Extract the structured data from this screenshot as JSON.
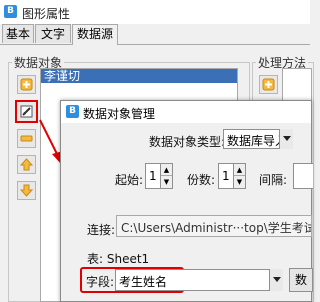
{
  "outer": {
    "title": "图形属性",
    "tabs": [
      "基本",
      "文字",
      "数据源"
    ],
    "data_objects_label": "数据对象",
    "data_objects_items": [
      "李谨切"
    ],
    "processing_label": "处理方法"
  },
  "dialog": {
    "title": "数据对象管理",
    "type_label": "数据对象类型:",
    "type_value": "数据库导入",
    "start_label": "起始:",
    "start_value": "1",
    "copies_label": "份数:",
    "copies_value": "1",
    "interval_label": "间隔:",
    "connection_label": "连接:",
    "connection_value": "C:\\Users\\Administr···top\\学生考试条码标签",
    "table_label": "表: Sheet1",
    "field_label": "字段:",
    "field_value": "考生姓名",
    "partial_button": "数"
  },
  "colors": {
    "highlight": "#e00000",
    "selection": "#3b6fb6"
  },
  "icons": [
    "app-icon",
    "add-icon",
    "edit-icon",
    "remove-icon",
    "move-up-icon",
    "move-down-icon",
    "dropdown-arrow-icon"
  ]
}
